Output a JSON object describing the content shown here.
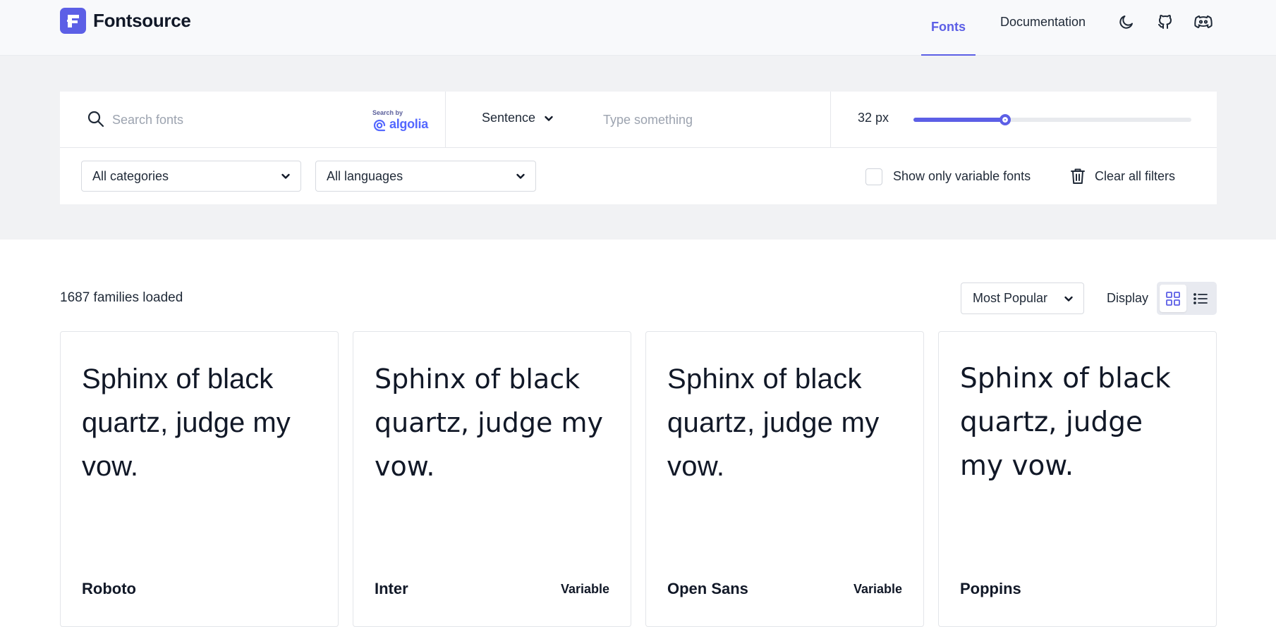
{
  "app": {
    "name": "Fontsource",
    "brand_color": "#5c5fe6"
  },
  "nav": {
    "fonts": "Fonts",
    "documentation": "Documentation",
    "icons": [
      "moon-icon",
      "github-icon",
      "discord-icon"
    ]
  },
  "search": {
    "placeholder": "Search fonts",
    "value": "",
    "powered_small": "Search by",
    "powered_brand": "algolia"
  },
  "preview": {
    "mode": "Sentence",
    "placeholder": "Type something",
    "value": ""
  },
  "size": {
    "label": "32 px",
    "slider_fraction": 0.33
  },
  "filters": {
    "category": "All categories",
    "language": "All languages",
    "variable_only_label": "Show only variable fonts",
    "variable_only_checked": false,
    "clear_label": "Clear all filters"
  },
  "results": {
    "count_text": "1687 families loaded",
    "sort": "Most Popular",
    "display_label": "Display",
    "active_view": "grid"
  },
  "cards": [
    {
      "preview": "Sphinx of black quartz, judge my vow.",
      "name": "Roboto",
      "tag": ""
    },
    {
      "preview": "Sphinx of black quartz, judge my vow.",
      "name": "Inter",
      "tag": "Variable"
    },
    {
      "preview": "Sphinx of black quartz, judge my vow.",
      "name": "Open Sans",
      "tag": "Variable"
    },
    {
      "preview": "Sphinx of black quartz, judge my vow.",
      "name": "Poppins",
      "tag": ""
    }
  ]
}
